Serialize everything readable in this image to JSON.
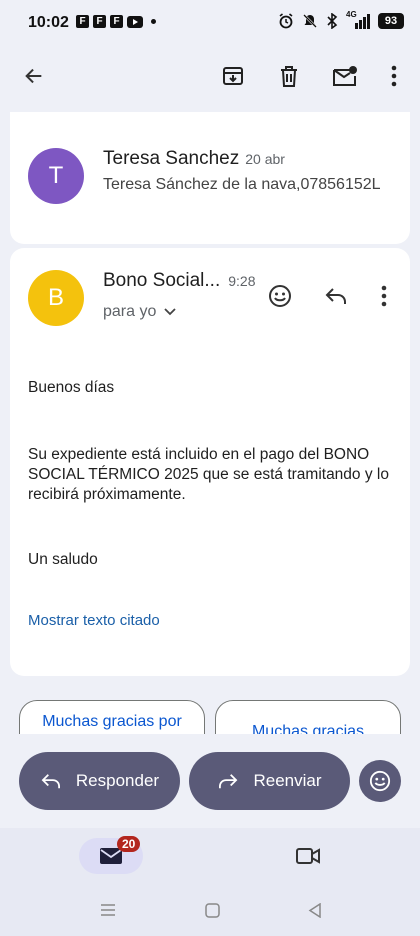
{
  "status_bar": {
    "time": "10:02",
    "app_icons": [
      "F",
      "F",
      "F"
    ],
    "network": "4G",
    "battery": "93"
  },
  "toolbar": {
    "back_icon": "arrow-back-icon",
    "archive_icon": "archive-icon",
    "delete_icon": "trash-icon",
    "mark_unread_icon": "mail-unread-icon",
    "more_icon": "more-vert-icon"
  },
  "message1": {
    "avatar_letter": "T",
    "avatar_color": "#7e57c2",
    "sender": "Teresa Sanchez",
    "date": "20 abr",
    "snippet": "Teresa Sánchez de la nava,07856152L"
  },
  "message2": {
    "avatar_letter": "B",
    "avatar_color": "#f4c20d",
    "sender": "Bono Social...",
    "time": "9:28",
    "recipient": "para yo",
    "greeting": "Buenos días",
    "body": "Su expediente está incluido en el pago del BONO SOCIAL TÉRMICO 2025 que se está tramitando y lo recibirá próximamente.",
    "closing": "Un saludo",
    "show_quoted": "Mostrar texto citado"
  },
  "smart_replies": [
    "Muchas gracias por",
    "Muchas gracias"
  ],
  "actions": {
    "reply": "Responder",
    "forward": "Reenviar"
  },
  "bottom_nav": {
    "mail_badge": "20"
  }
}
